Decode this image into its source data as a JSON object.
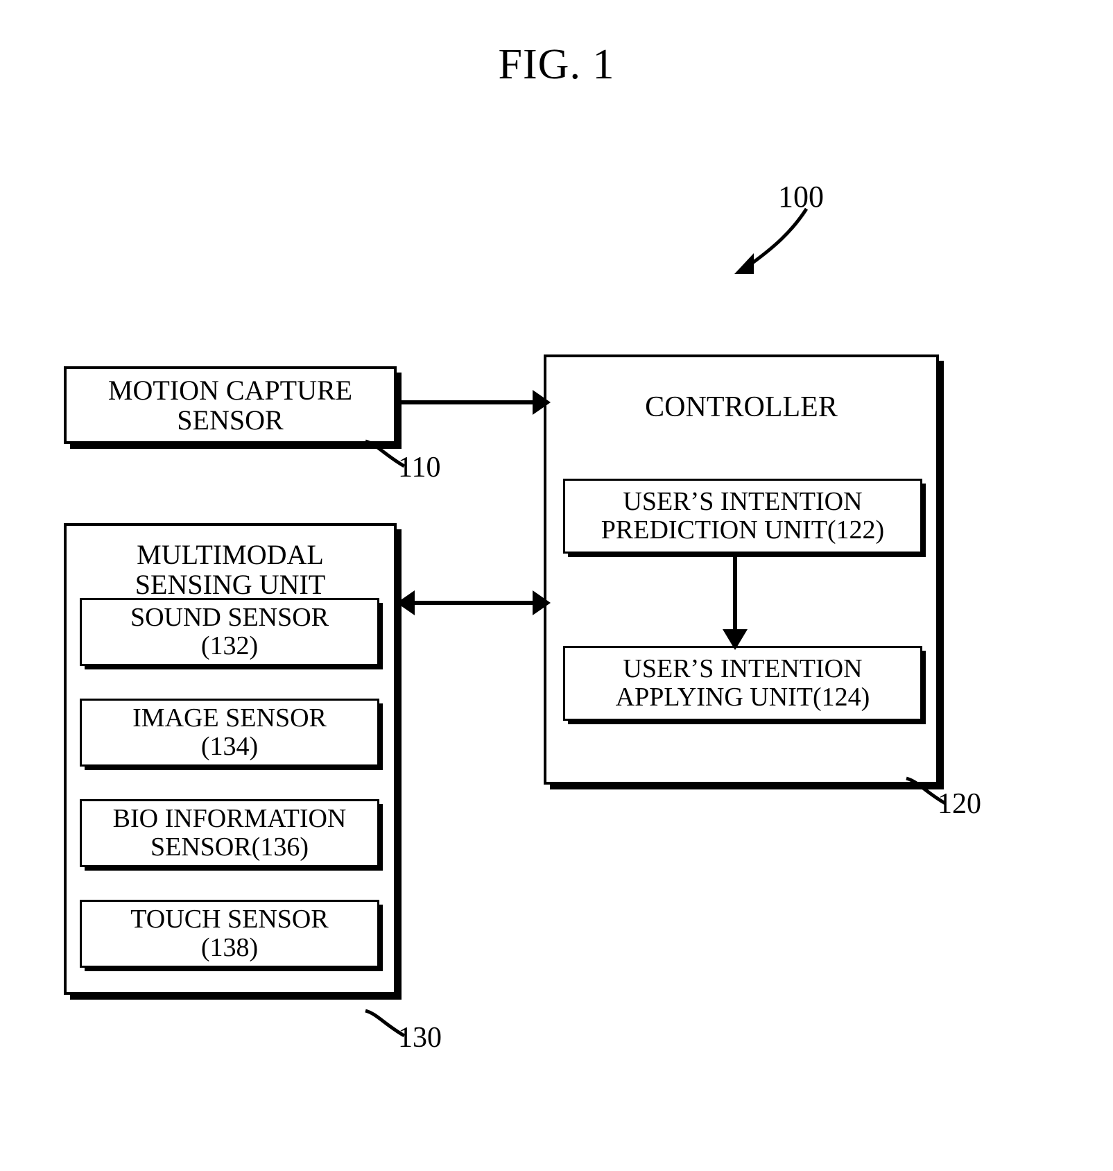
{
  "figure": {
    "title": "FIG. 1",
    "system_reference": "100"
  },
  "blocks": {
    "motion_capture_sensor": {
      "line1": "MOTION CAPTURE",
      "line2": "SENSOR",
      "reference": "110"
    },
    "controller": {
      "title": "CONTROLLER",
      "reference": "120",
      "units": [
        {
          "line1": "USER’S INTENTION",
          "line2": "PREDICTION UNIT(122)",
          "reference": "122"
        },
        {
          "line1": "USER’S INTENTION",
          "line2": "APPLYING UNIT(124)",
          "reference": "124"
        }
      ]
    },
    "multimodal_sensing_unit": {
      "line1": "MULTIMODAL",
      "line2": "SENSING UNIT",
      "reference": "130",
      "sensors": [
        {
          "line1": "SOUND SENSOR",
          "line2": "(132)",
          "reference": "132"
        },
        {
          "line1": "IMAGE SENSOR",
          "line2": "(134)",
          "reference": "134"
        },
        {
          "line1": "BIO INFORMATION",
          "line2": "SENSOR(136)",
          "reference": "136"
        },
        {
          "line1": "TOUCH SENSOR",
          "line2": "(138)",
          "reference": "138"
        }
      ]
    }
  },
  "connectors": [
    {
      "name": "motion-capture-to-controller",
      "direction": "one-way"
    },
    {
      "name": "multimodal-to-controller",
      "direction": "two-way"
    },
    {
      "name": "prediction-to-applying",
      "direction": "one-way"
    }
  ],
  "style": {
    "ink": "#000000",
    "paper": "#ffffff"
  }
}
